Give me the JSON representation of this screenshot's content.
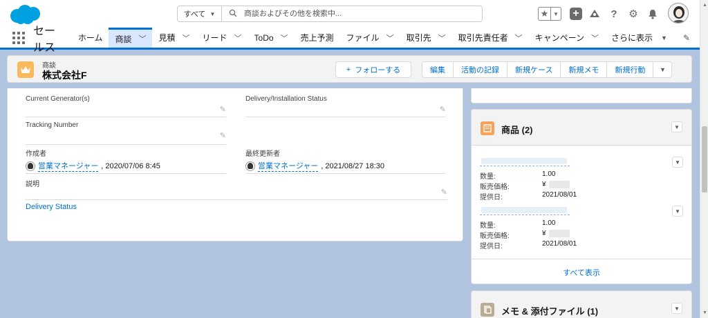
{
  "header": {
    "search_scope": "すべて",
    "search_placeholder": "商談およびその他を検索中..."
  },
  "nav": {
    "app_name": "セールス",
    "tabs": [
      {
        "label": "ホーム",
        "dropdown": false
      },
      {
        "label": "商談",
        "dropdown": true,
        "active": true
      },
      {
        "label": "見積",
        "dropdown": true
      },
      {
        "label": "リード",
        "dropdown": true
      },
      {
        "label": "ToDo",
        "dropdown": true
      },
      {
        "label": "売上予測",
        "dropdown": false
      },
      {
        "label": "ファイル",
        "dropdown": true
      },
      {
        "label": "取引先",
        "dropdown": true
      },
      {
        "label": "取引先責任者",
        "dropdown": true
      },
      {
        "label": "キャンペーン",
        "dropdown": true
      }
    ],
    "more_label": "さらに表示"
  },
  "record": {
    "object_type": "商談",
    "name": "株式会社F",
    "follow_label": "フォローする",
    "actions": [
      "編集",
      "活動の記録",
      "新規ケース",
      "新規メモ",
      "新規行動"
    ]
  },
  "details": {
    "fields": [
      {
        "label": "Current Generator(s)",
        "value": ""
      },
      {
        "label": "Delivery/Installation Status",
        "value": ""
      },
      {
        "label": "Tracking Number",
        "value": ""
      },
      {
        "label": "作成者",
        "user": "営業マネージャー",
        "date": ", 2020/07/06 8:45"
      },
      {
        "label": "最終更新者",
        "user": "営業マネージャー",
        "date": ", 2021/08/27 18:30"
      },
      {
        "label": "説明",
        "value": ""
      }
    ],
    "delivery_status_link": "Delivery Status"
  },
  "products": {
    "title": "商品 (2)",
    "items": [
      {
        "quantity_label": "数量:",
        "quantity": "1.00",
        "price_label": "販売価格:",
        "price_prefix": "¥",
        "date_label": "提供日:",
        "date": "2021/08/01"
      },
      {
        "quantity_label": "数量:",
        "quantity": "1.00",
        "price_label": "販売価格:",
        "price_prefix": "¥",
        "date_label": "提供日:",
        "date": "2021/08/01"
      }
    ],
    "view_all": "すべて表示"
  },
  "files": {
    "title": "メモ & 添付ファイル (1)"
  },
  "colors": {
    "brand_blue": "#0070d2",
    "opportunity_icon": "#fcb95b",
    "product_icon": "#f7a25a",
    "files_icon": "#baac93",
    "page_background": "#b0c4df"
  },
  "icons": [
    "salesforce-cloud-logo",
    "search-icon",
    "star-icon",
    "plus-icon",
    "trailhead-icon",
    "help-icon",
    "gear-icon",
    "bell-icon",
    "crown-icon",
    "pencil-icon"
  ]
}
